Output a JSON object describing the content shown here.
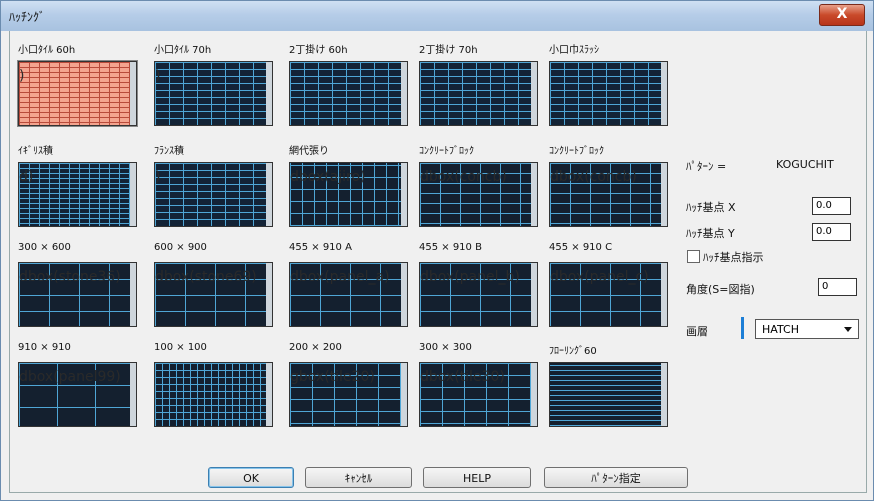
{
  "window": {
    "title": "ﾊｯﾁﾝｸﾞ",
    "close_glyph": "X"
  },
  "patterns": [
    {
      "label": "小口ﾀｲﾙ 60h",
      "ghost": ")",
      "style": "pink"
    },
    {
      "label": "小口ﾀｲﾙ 70h",
      "ghost": ")",
      "style": "blue"
    },
    {
      "label": "2丁掛け 60h",
      "ghost": "",
      "style": "blue"
    },
    {
      "label": "2丁掛け 70h",
      "ghost": "",
      "style": "blue"
    },
    {
      "label": "小口巾ｽﾗｯｼ",
      "ghost": "",
      "style": "blue"
    },
    {
      "label": "ｲｷﾞﾘｽ積",
      "ghost": "d)",
      "style": "fine"
    },
    {
      "label": "ﾌﾗﾝｽ積",
      "ghost": ")",
      "style": "blue"
    },
    {
      "label": "網代張り",
      "ghost": "dbox(ajiro)",
      "style": "herring"
    },
    {
      "label": "ｺﾝｸﾘｰﾄﾌﾞﾛｯｸ",
      "ghost": "dbox(concb)",
      "style": "mid"
    },
    {
      "label": "ｺﾝｸﾘｰﾄﾌﾞﾛｯｸ",
      "ghost": "dbox(concb)",
      "style": "mid"
    },
    {
      "label": "300 × 600",
      "ghost": "dbox(stone36)",
      "style": "big"
    },
    {
      "label": "600 × 900",
      "ghost": "dbox(stone69)",
      "style": "big"
    },
    {
      "label": "455 × 910 A",
      "ghost": "dbox(panel_a)",
      "style": "big"
    },
    {
      "label": "455 × 910 B",
      "ghost": "dbox(panel_b)",
      "style": "big"
    },
    {
      "label": "455 × 910 C",
      "ghost": "dbox(panel_c)",
      "style": "big"
    },
    {
      "label": "910 × 910",
      "ghost": "dbox(panel99)",
      "style": "grid-big"
    },
    {
      "label": "100 × 100",
      "ghost": "",
      "style": "grid-fine"
    },
    {
      "label": "200 × 200",
      "ghost": "gbox(tile20)",
      "style": "grid-mid"
    },
    {
      "label": "300 × 300",
      "ghost": "dbox(tile30)",
      "style": "grid-mid"
    },
    {
      "label": "ﾌﾛｰﾘﾝｸﾞ60",
      "ghost": "",
      "style": "flooring"
    }
  ],
  "panel": {
    "pattern_label": "ﾊﾟﾀｰﾝ =",
    "pattern_value": "KOGUCHIT",
    "base_x_label": "ﾊｯﾁ基点 X",
    "base_x_value": "0.0",
    "base_y_label": "ﾊｯﾁ基点 Y",
    "base_y_value": "0.0",
    "base_point_check_label": "ﾊｯﾁ基点指示",
    "angle_label": "角度(S=図指)",
    "angle_value": "0",
    "layer_label": "画層",
    "layer_value": "HATCH"
  },
  "buttons": {
    "ok": "OK",
    "cancel": "ｷｬﾝｾﾙ",
    "help": "HELP",
    "pattern_select": "ﾊﾟﾀｰﾝ指定"
  },
  "colors": {
    "hatch_line": "#4fa6d6",
    "tile_bg": "#132336",
    "selected_tile": "#f4a48f"
  }
}
